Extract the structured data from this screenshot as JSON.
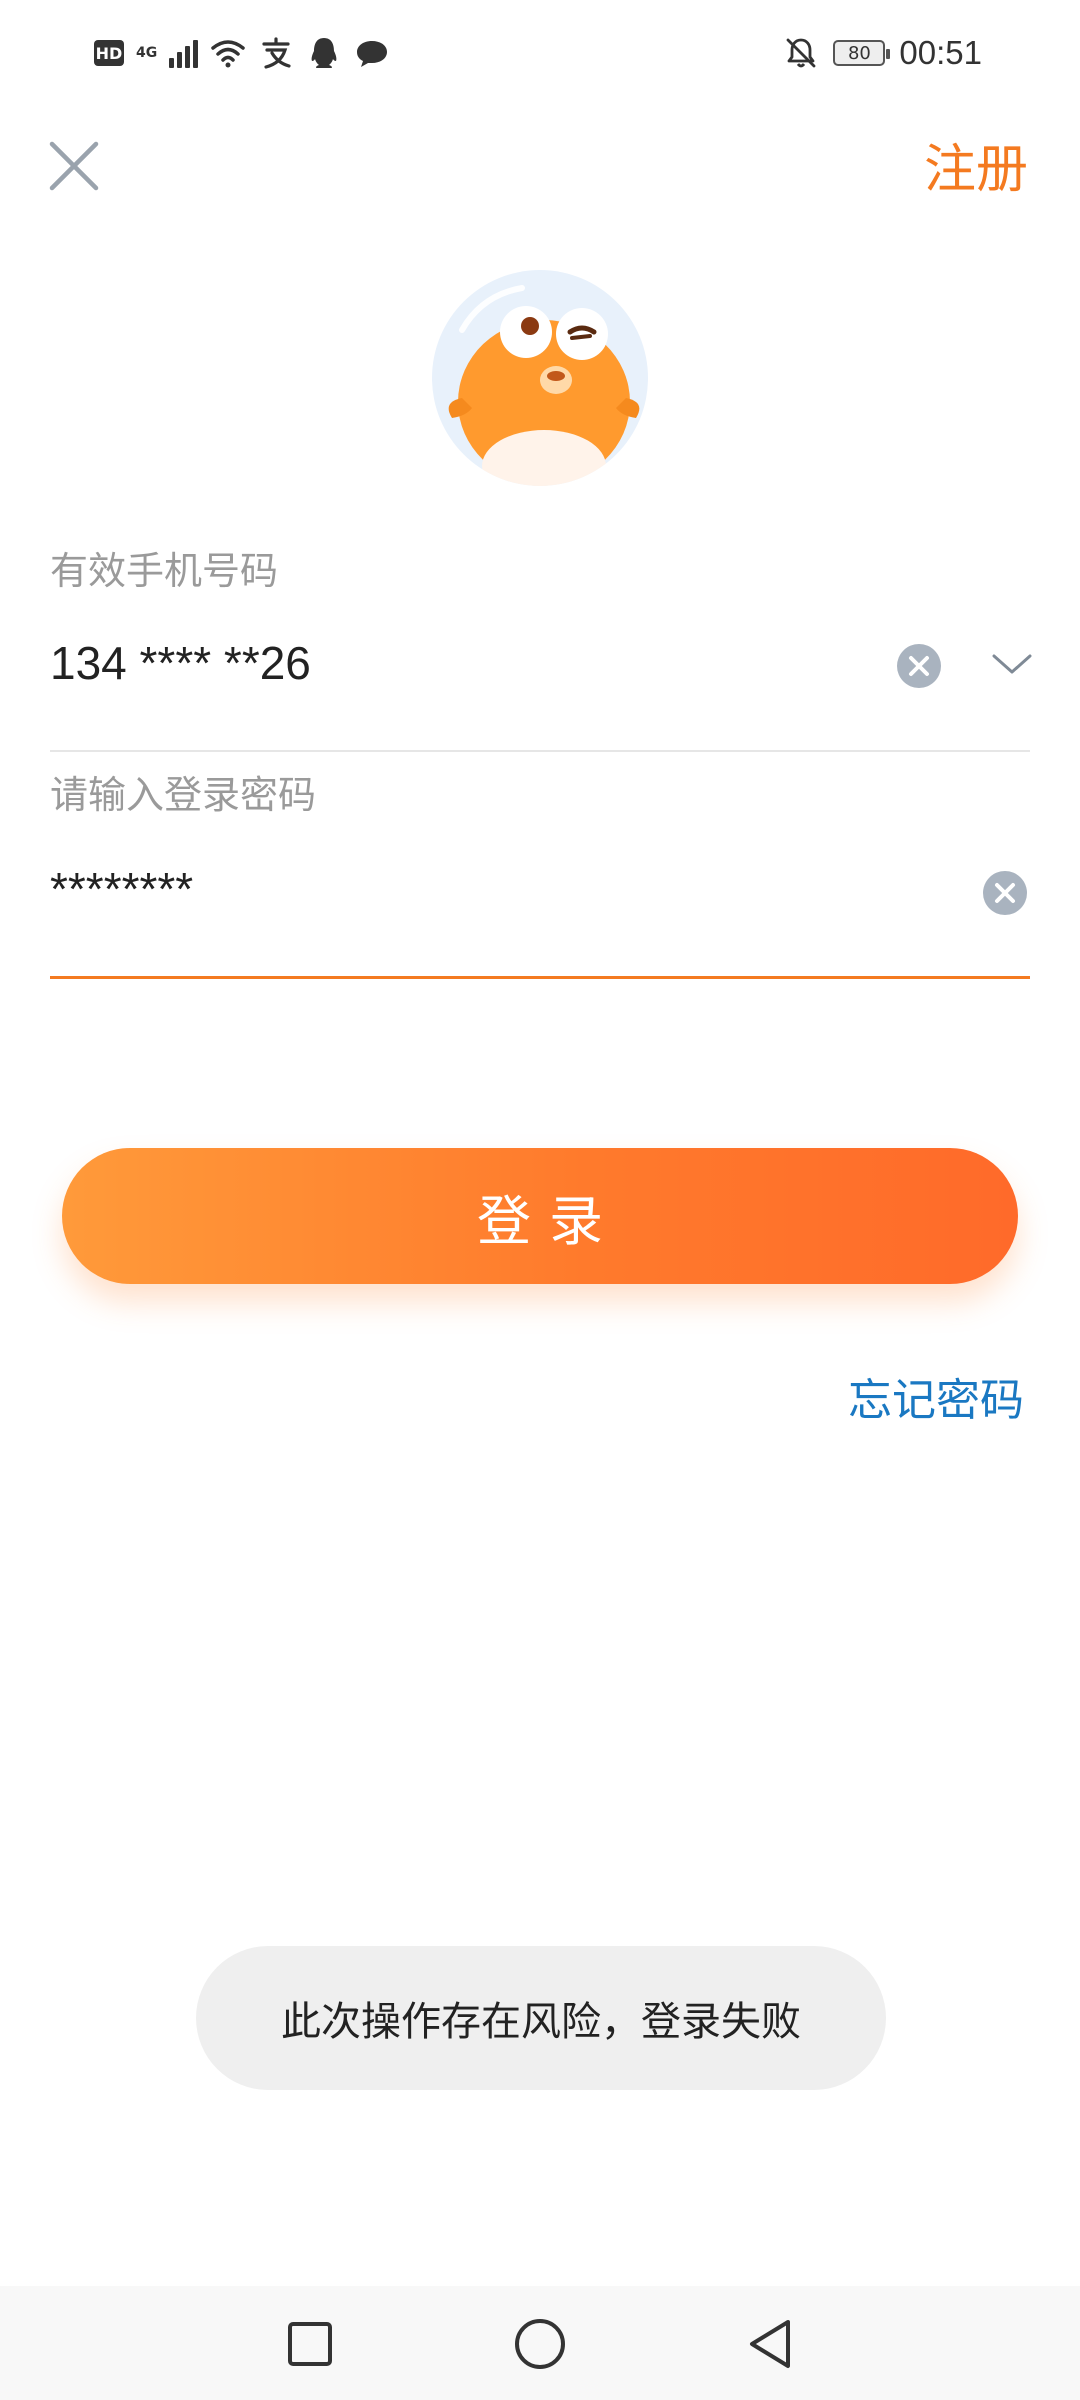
{
  "status_bar": {
    "hd": "HD",
    "network": "4G",
    "battery": "80",
    "time": "00:51",
    "icons": [
      "hd-icon",
      "signal-icon",
      "wifi-icon",
      "alipay-icon",
      "qq-icon",
      "message-icon",
      "mute-icon",
      "battery-icon"
    ]
  },
  "header": {
    "register_label": "注册",
    "close_icon": "close-icon"
  },
  "form": {
    "phone_label": "有效手机号码",
    "phone_value": "134 **** **26",
    "password_label": "请输入登录密码",
    "password_value": "********"
  },
  "actions": {
    "login_label": "登录",
    "forgot_label": "忘记密码"
  },
  "toast": {
    "message": "此次操作存在风险，登录失败"
  },
  "colors": {
    "accent": "#f47a20",
    "link": "#1a78c2",
    "button_gradient_start": "#ff9a3a",
    "button_gradient_end": "#ff6a2a"
  },
  "nav": {
    "icons": [
      "recent-apps-icon",
      "home-icon",
      "back-icon"
    ]
  }
}
